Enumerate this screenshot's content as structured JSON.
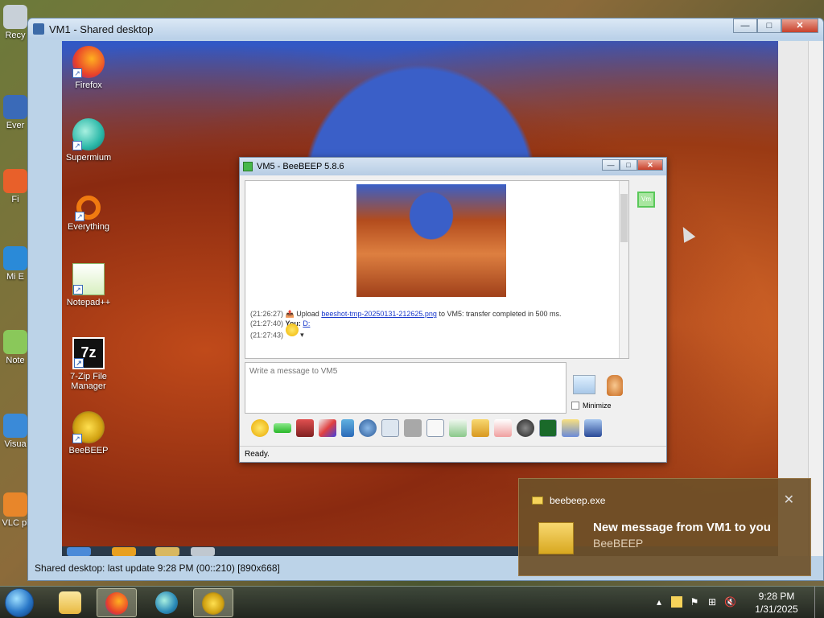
{
  "host_desktop": {
    "icons": [
      "Recy",
      "Ever",
      "Fi",
      "Mi E",
      "Note",
      "Visua",
      "VLC pl"
    ]
  },
  "vm_window": {
    "title": "VM1 - Shared desktop",
    "minimize": "—",
    "maximize": "□",
    "close": "✕",
    "status": "Shared desktop: last update 9:28 PM (00::210) [890x668]"
  },
  "guest_desktop": {
    "icons": [
      {
        "label": "Firefox"
      },
      {
        "label": "Supermium"
      },
      {
        "label": "Everything"
      },
      {
        "label": "Notepad++"
      },
      {
        "label": "7-Zip File Manager"
      },
      {
        "label": "BeeBEEP"
      }
    ]
  },
  "chat": {
    "title": "VM5 - BeeBEEP 5.8.6",
    "user_badge": "Vm",
    "messages": [
      {
        "time": "(21:26:27)",
        "text": "Upload ",
        "link": "beeshot-tmp-20250131-212625.png",
        "text2": " to VM5: transfer completed in 500 ms."
      },
      {
        "time": "(21:27:40)",
        "sender": "You:",
        "text": "D:"
      },
      {
        "time": "(21:27:43)"
      }
    ],
    "input_placeholder": "Write a message to VM5",
    "minimize_label": "Minimize",
    "status": "Ready."
  },
  "toast": {
    "app": "beebeep.exe",
    "close": "✕",
    "headline": "New message from VM1 to you",
    "sub": "BeeBEEP"
  },
  "clock": {
    "time": "9:28 PM",
    "date": "1/31/2025"
  },
  "colors": {
    "accent": "#3a6ab8",
    "toast_bg": "#6e5028",
    "status_green": "#5ac85a"
  }
}
